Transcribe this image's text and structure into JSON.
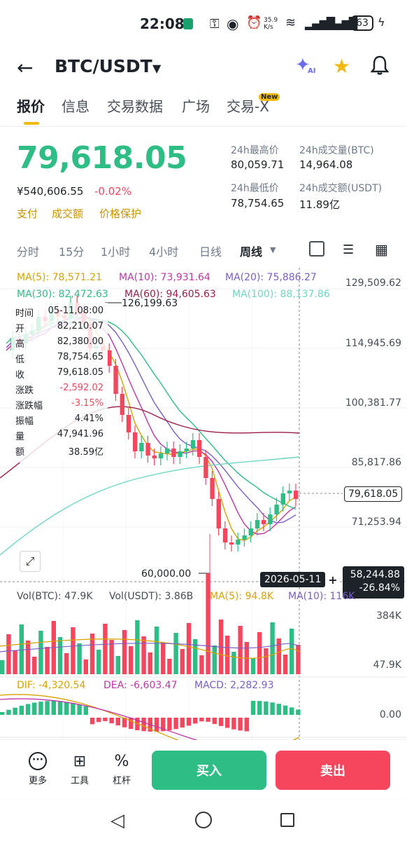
{
  "status": {
    "time": "22:08",
    "net": "35.9 K/s",
    "battery": "63"
  },
  "header": {
    "pair": "BTC/USDT"
  },
  "tabs": [
    "报价",
    "信息",
    "交易数据",
    "广场",
    "交易-X"
  ],
  "tab_badge": "New",
  "price": {
    "last": "79,618.05",
    "cny": "¥540,606.55",
    "change": "-0.02%"
  },
  "links": [
    "支付",
    "成交额",
    "价格保护"
  ],
  "stats": {
    "high_label": "24h最高价",
    "high": "80,059.71",
    "vol_btc_label": "24h成交量(BTC)",
    "vol_btc": "14,964.08",
    "low_label": "24h最低价",
    "low": "78,754.65",
    "vol_usdt_label": "24h成交额(USDT)",
    "vol_usdt": "11.89亿"
  },
  "intervals": [
    "分时",
    "15分",
    "1小时",
    "4小时",
    "日线",
    "周线"
  ],
  "ma": {
    "ma5": "MA(5): 78,571.21",
    "ma10": "MA(10): 73,931.64",
    "ma20": "MA(20): 75,886.27",
    "ma30": "MA(30): 82,472.63",
    "ma60": "MA(60): 94,605.63",
    "ma100": "MA(100): 88,137.86"
  },
  "price_axis": [
    "129,509.62",
    "114,945.69",
    "100,381.77",
    "85,817.86",
    "71,253.94"
  ],
  "high_marker": "126,199.63",
  "low_marker": "60,000.00",
  "current_tag": "79,618.05",
  "crosshair": {
    "date": "2026-05-11",
    "price": "58,244.88",
    "pct": "-26.84%"
  },
  "ohlc": [
    {
      "k": "时间",
      "v": "05-11,08:00"
    },
    {
      "k": "开",
      "v": "82,210.07"
    },
    {
      "k": "高",
      "v": "82,380.00"
    },
    {
      "k": "低",
      "v": "78,754.65"
    },
    {
      "k": "收",
      "v": "79,618.05"
    },
    {
      "k": "涨跌",
      "v": "-2,592.02"
    },
    {
      "k": "涨跌幅",
      "v": "-3.15%"
    },
    {
      "k": "振幅",
      "v": "4.41%"
    },
    {
      "k": "量",
      "v": "47,941.96"
    },
    {
      "k": "额",
      "v": "38.59亿"
    }
  ],
  "vol": {
    "btc": "Vol(BTC): 47.9K",
    "usdt": "Vol(USDT): 3.86B",
    "ma5": "MA(5): 94.8K",
    "ma10": "MA(10): 116K",
    "axis_top": "384K",
    "axis_bot": "47.9K"
  },
  "macd": {
    "dif": "DIF: -4,320.54",
    "dea": "DEA: -6,603.47",
    "macd": "MACD: 2,282.93",
    "axis": "0.00"
  },
  "bottom": {
    "more": "更多",
    "tools": "工具",
    "leverage": "杠杆",
    "buy": "买入",
    "sell": "卖出"
  },
  "colors": {
    "up": "#2ebd85",
    "down": "#f6465d",
    "brand": "#f0b90b"
  }
}
